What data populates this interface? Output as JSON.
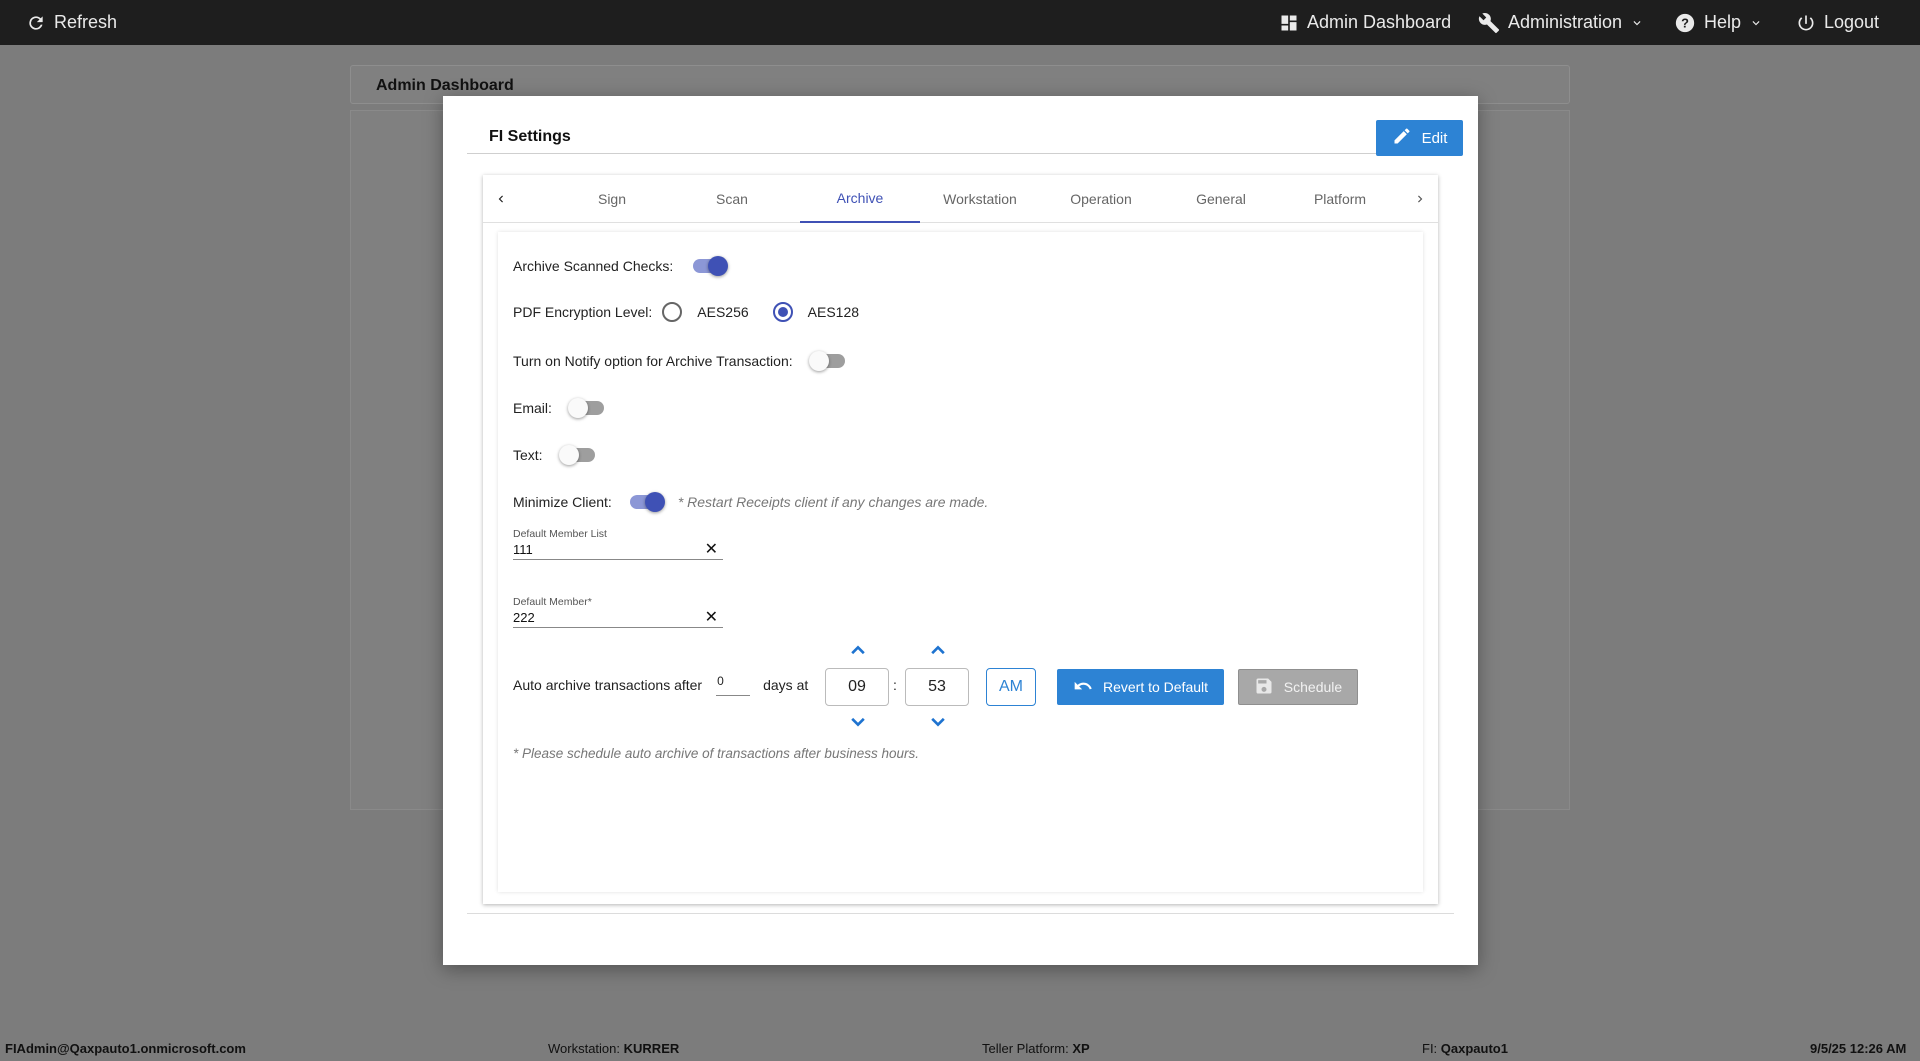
{
  "topbar": {
    "refresh_label": "Refresh",
    "admin_dashboard_label": "Admin Dashboard",
    "administration_label": "Administration",
    "help_label": "Help",
    "logout_label": "Logout"
  },
  "background": {
    "card_title": "Admin Dashboard"
  },
  "modal": {
    "title": "FI Settings",
    "edit_label": "Edit",
    "tabs": [
      {
        "label": "Sign"
      },
      {
        "label": "Scan"
      },
      {
        "label": "Archive",
        "active": true
      },
      {
        "label": "Workstation"
      },
      {
        "label": "Operation"
      },
      {
        "label": "General"
      },
      {
        "label": "Platform"
      }
    ],
    "archive": {
      "archive_scanned_checks_label": "Archive Scanned Checks:",
      "archive_scanned_checks_on": true,
      "pdf_encryption_label": "PDF Encryption Level:",
      "encryption_options": [
        "AES256",
        "AES128"
      ],
      "encryption_selected": "AES128",
      "notify_label": "Turn on Notify option for Archive Transaction:",
      "notify_on": false,
      "email_label": "Email:",
      "email_on": false,
      "text_label": "Text:",
      "text_on": false,
      "minimize_client_label": "Minimize Client:",
      "minimize_client_on": true,
      "minimize_hint": "* Restart Receipts client if any changes are made.",
      "default_member_list_label": "Default Member List",
      "default_member_list_value": "111",
      "default_member_label": "Default Member*",
      "default_member_value": "222",
      "auto_archive_prefix": "Auto archive transactions after",
      "auto_archive_days": "0",
      "days_at_label": "days at",
      "hour": "09",
      "time_separator": ":",
      "minute": "53",
      "ampm": "AM",
      "revert_label": "Revert to Default",
      "schedule_label": "Schedule",
      "schedule_hint": "* Please schedule auto archive of transactions after business hours."
    }
  },
  "footer": {
    "user": "FIAdmin@Qaxpauto1.onmicrosoft.com",
    "workstation_label": "Workstation:",
    "workstation_value": "KURRER",
    "teller_platform_label": "Teller Platform:",
    "teller_platform_value": "XP",
    "fi_label": "FI:",
    "fi_value": "Qaxpauto1",
    "datetime": "9/5/25 12:26 AM"
  },
  "colors": {
    "accent_blue": "#2d83d4",
    "indigo": "#3f51b5",
    "topbar": "#1e1e1e",
    "overlay": "#7c7c7c"
  }
}
